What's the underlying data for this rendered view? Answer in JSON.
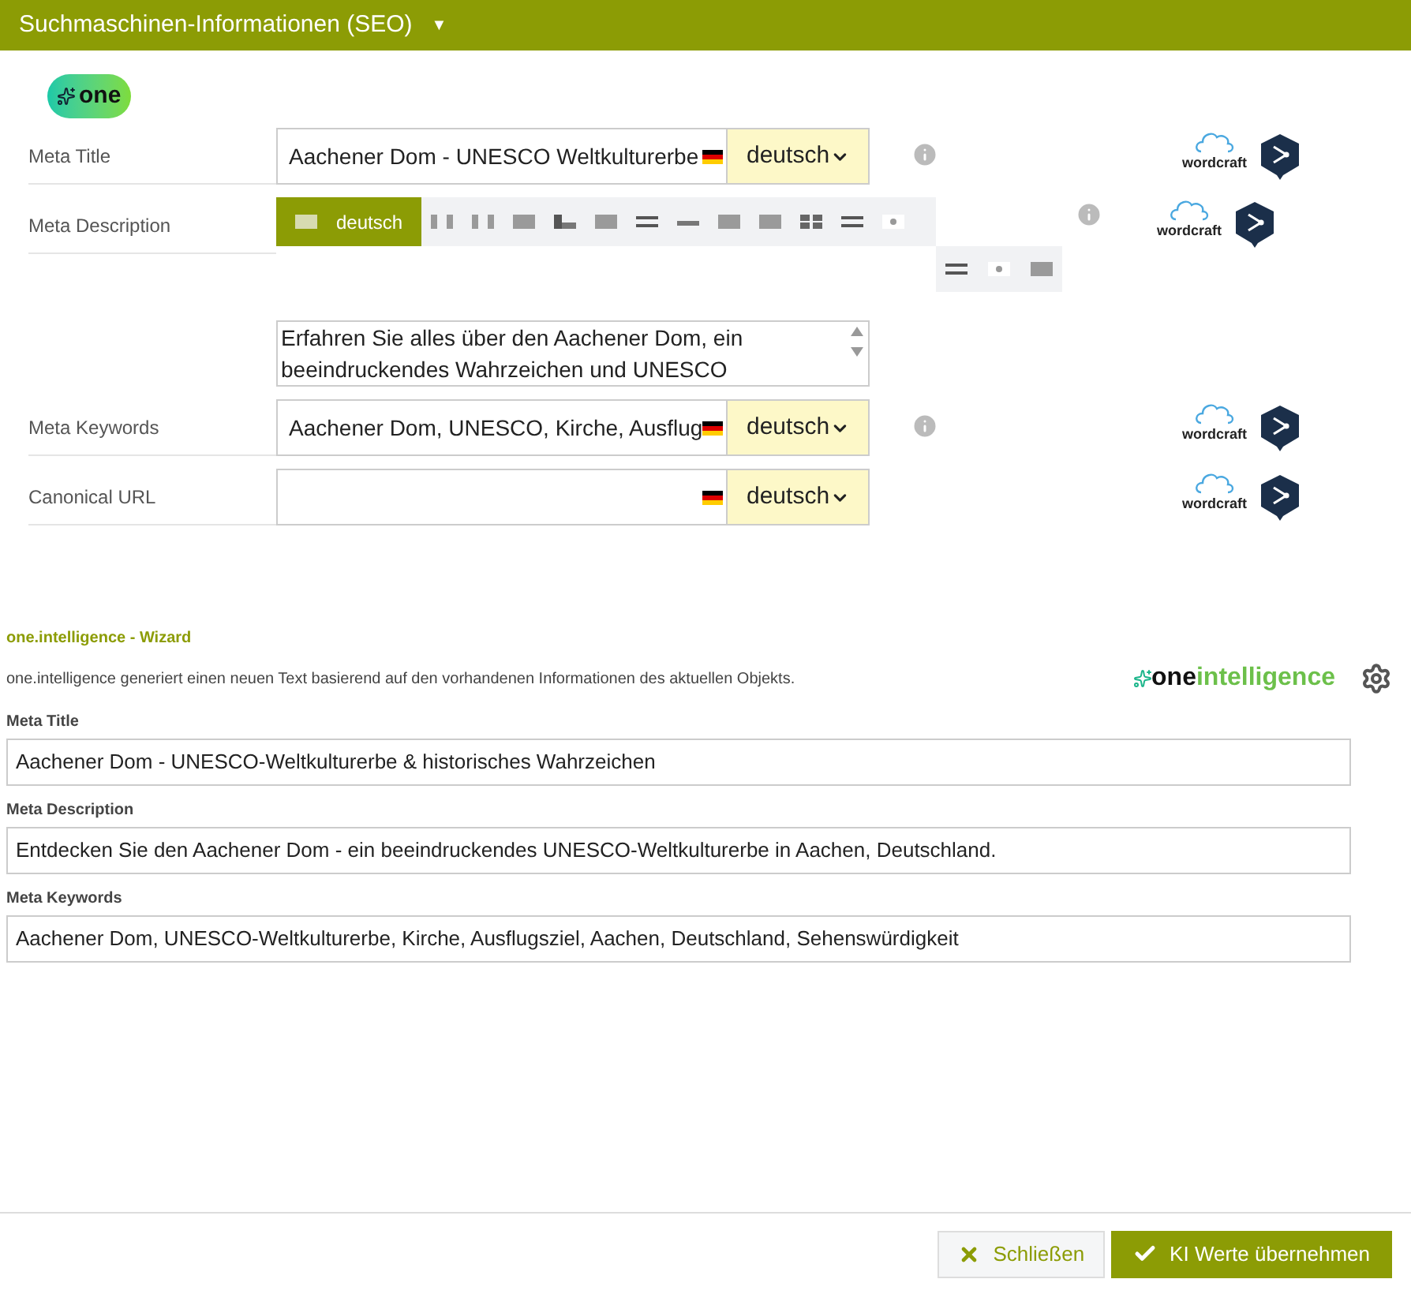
{
  "header": {
    "title": "Suchmaschinen-Informationen (SEO)",
    "caret": "▼"
  },
  "badge": {
    "text": "one"
  },
  "fields": [
    {
      "kind": "input",
      "label": "Meta Title",
      "value": "Aachener Dom - UNESCO Weltkulturerbe",
      "language": "deutsch",
      "info": true,
      "wordcraft": "wordcraft"
    },
    {
      "kind": "translate",
      "label": "Meta Description",
      "languages": [
        {
          "label": "deutsch",
          "selected": true
        },
        {
          "selected": false
        },
        {
          "selected": false
        },
        {
          "selected": false
        },
        {
          "selected": false
        },
        {
          "selected": false
        },
        {
          "selected": false
        },
        {
          "selected": false
        },
        {
          "selected": false
        },
        {
          "selected": false
        },
        {
          "selected": false
        },
        {
          "selected": false
        },
        {
          "selected": false
        },
        {
          "selected": false
        },
        {
          "selected": false
        },
        {
          "selected": false
        }
      ],
      "value": "Erfahren Sie alles über den Aachener Dom, ein beeindruckendes Wahrzeichen und UNESCO",
      "info": true,
      "wordcraft": "wordcraft"
    },
    {
      "kind": "input",
      "label": "Meta Keywords",
      "value": "Aachener Dom, UNESCO, Kirche, Ausflug",
      "language": "deutsch",
      "info": true,
      "wordcraft": "wordcraft"
    },
    {
      "kind": "input",
      "label": "Canonical URL",
      "language": "deutsch",
      "info": false,
      "wordcraft": "wordcraft"
    }
  ],
  "wizard": {
    "title": "one.intelligence - Wizard",
    "description": "one.intelligence generiert einen neuen Text basierend auf den vorhandenen Informationen des aktuellen Objekts.",
    "logo_part_1": "one",
    "logo_part_2": "intelligence",
    "fields": [
      {
        "label": "Meta Title",
        "value": "Aachener Dom - UNESCO-Weltkulturerbe & historisches Wahrzeichen"
      },
      {
        "label": "Meta Description",
        "value": "Entdecken Sie den Aachener Dom - ein beeindruckendes UNESCO-Weltkulturerbe in Aachen, Deutschland."
      },
      {
        "label": "Meta Keywords",
        "value": "Aachener Dom, UNESCO-Weltkulturerbe, Kirche, Ausflugsziel, Aachen, Deutschland, Sehenswürdigkeit"
      }
    ]
  },
  "buttons": [
    {
      "kind": "close",
      "label": "Schließen"
    },
    {
      "kind": "apply",
      "label": "KI Werte übernehmen"
    }
  ]
}
